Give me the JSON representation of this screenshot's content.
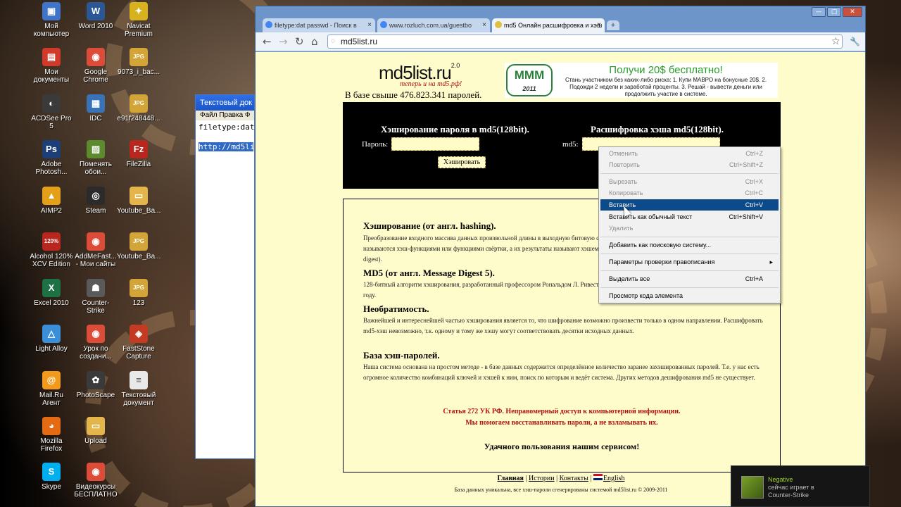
{
  "desktop": {
    "icons": [
      {
        "label": "Мой компьютер",
        "glyph": "▣",
        "color": "#3f74c8"
      },
      {
        "label": "Word 2010",
        "glyph": "W",
        "color": "#2b5797"
      },
      {
        "label": "Navicat Premium",
        "glyph": "✦",
        "color": "#d7b21e"
      },
      {
        "label": "Мои документы",
        "glyph": "▤",
        "color": "#cf3a2a"
      },
      {
        "label": "Google Chrome",
        "glyph": "◉",
        "color": "#dd4b39"
      },
      {
        "label": "9073_i_bac...",
        "glyph": "JPG",
        "color": "#d3a437"
      },
      {
        "label": "ACDSee Pro 5",
        "glyph": "◐",
        "color": "#3a3a3a"
      },
      {
        "label": "IDC",
        "glyph": "▦",
        "color": "#3a72b8"
      },
      {
        "label": "e91f248448...",
        "glyph": "JPG",
        "color": "#d3a437"
      },
      {
        "label": "Adobe Photosh...",
        "glyph": "Ps",
        "color": "#1d3f77"
      },
      {
        "label": "Поменять обои...",
        "glyph": "▨",
        "color": "#5c8b2e"
      },
      {
        "label": "FileZilla",
        "glyph": "Fz",
        "color": "#b8261e"
      },
      {
        "label": "AIMP2",
        "glyph": "▲",
        "color": "#e5a01a"
      },
      {
        "label": "Steam",
        "glyph": "◎",
        "color": "#2b2b2b"
      },
      {
        "label": "Youtube_Ba...",
        "glyph": "▭",
        "color": "#e3b54a"
      },
      {
        "label": "Alcohol 120% XCV Edition",
        "glyph": "120%",
        "color": "#b8261e"
      },
      {
        "label": "AddMeFast... - Мои сайты",
        "glyph": "◉",
        "color": "#dd4b39"
      },
      {
        "label": "Youtube_Ba...",
        "glyph": "JPG",
        "color": "#d3a437"
      },
      {
        "label": "Excel 2010",
        "glyph": "X",
        "color": "#1e7145"
      },
      {
        "label": "Counter-Strike",
        "glyph": "☗",
        "color": "#5a5a5a"
      },
      {
        "label": "123",
        "glyph": "JPG",
        "color": "#d3a437"
      },
      {
        "label": "Light Alloy",
        "glyph": "△",
        "color": "#3a8fd8"
      },
      {
        "label": "Урок по создани...",
        "glyph": "◉",
        "color": "#dd4b39"
      },
      {
        "label": "FastStone Capture",
        "glyph": "◈",
        "color": "#c23b22"
      },
      {
        "label": "Mail.Ru Агент",
        "glyph": "@",
        "color": "#f39a1d"
      },
      {
        "label": "PhotoScape",
        "glyph": "✿",
        "color": "#3a3a3a"
      },
      {
        "label": "Текстовый документ",
        "glyph": "≡",
        "color": "#e9e9e9"
      },
      {
        "label": "Mozilla Firefox",
        "glyph": "◕",
        "color": "#e46a14"
      },
      {
        "label": "Upload",
        "glyph": "▭",
        "color": "#e3b54a"
      },
      {
        "label": "Skype",
        "glyph": "S",
        "color": "#00aff0"
      },
      {
        "label": "Видеокурсы БЕСПЛАТНО",
        "glyph": "◉",
        "color": "#dd4b39"
      }
    ]
  },
  "notepad": {
    "title": "Текстовый док",
    "menu": "Файл  Правка  Ф",
    "line1": "filetype:dat",
    "selected": "http://md5li"
  },
  "browser": {
    "tabs": [
      {
        "label": "filetype:dat passwd - Поиск в",
        "fav": "#4285f4"
      },
      {
        "label": "www.rozluch.com.ua/guestbo",
        "fav": "#4285f4"
      },
      {
        "label": "md5 Онлайн расшифровка и хэш",
        "fav": "#e0c040"
      }
    ],
    "url": "md5list.ru",
    "win": {
      "min": "—",
      "max": "▢",
      "close": "✕"
    },
    "nav": {
      "back": "←",
      "fwd": "→",
      "reload": "↻",
      "home": "⌂",
      "star": "☆",
      "wrench": "🔧"
    }
  },
  "page": {
    "logo": "md5list.ru",
    "logo_ver": "2.0",
    "tagline": "теперь и на md5.рф!",
    "counter": "В базе свыше 476.823.341 паролей.",
    "ad": {
      "logo": "МММ",
      "year": "2011",
      "title": "Получи 20$ бесплатно!",
      "text": "Стань участником без каких-либо риска: 1. Купи МАВРО на бонусные 20$. 2. Подожди 2 недели и заработай проценты. 3. Решай - вывести деньги или продолжить участие в системе."
    },
    "hash_title": "Хэширование пароля в md5(128bit).",
    "decode_title": "Расшифровка хэша md5(128bit).",
    "password_label": "Пароль:",
    "md5_label": "md5:",
    "hash_button": "Хэшировать",
    "sections": [
      {
        "h": "Хэширование (от англ. hashing).",
        "t": "Преобразование входного массива данных произвольной длины в выходную битовую строку фиксированной длины. Такие преобразования также называются хэш-функциями или функциями свёртки, а их результаты называют хэшем, хэш-кодом или дайджестом сообщения (англ. message digest)."
      },
      {
        "h": "MD5 (от англ. Message Digest 5).",
        "t": "128-битный алгоритм хэширования, разработанный профессором Рональдом Л. Ривестом из Массачусетского технологического института в 1991 году."
      },
      {
        "h": "Необратимость.",
        "t": "Важнейшей и интереснейшей частью хэширования является то, что шифрование возможно произвести только в одном направлении. Расшифровать md5-хэш невозможно, т.к. одному и тому же хэшу могут соответствовать десятки исходных данных."
      },
      {
        "h": "База хэш-паролей.",
        "t": "Наша система основана на простом методе - в базе данных содержится определённое количество заранее захэшированных паролей. Т.е. у нас есть огромное количество комбинаций ключей и хэшей к ним, поиск по которым и ведёт система. Других методов дешифрования md5 не существует."
      }
    ],
    "warning1": "Статья 272 УК РФ. Неправомерный доступ к компьютерной информации.",
    "warning2": "Мы помогаем восстанавливать пароли, а не взламывать их.",
    "thanks": "Удачного пользования нашим сервисом!",
    "footer_links": [
      "Главная",
      "Истории",
      "Контакты",
      "English"
    ],
    "copyright": "База данных уникальна, все хэш-пароли сгенерированы системой md5list.ru © 2009-2011"
  },
  "context_menu": [
    {
      "label": "Отменить",
      "shortcut": "Ctrl+Z",
      "disabled": true
    },
    {
      "label": "Повторить",
      "shortcut": "Ctrl+Shift+Z",
      "disabled": true
    },
    {
      "label": "Вырезать",
      "shortcut": "Ctrl+X",
      "disabled": true
    },
    {
      "label": "Копировать",
      "shortcut": "Ctrl+C",
      "disabled": true
    },
    {
      "label": "Вставить",
      "shortcut": "Ctrl+V",
      "highlighted": true
    },
    {
      "label": "Вставить как обычный текст",
      "shortcut": "Ctrl+Shift+V"
    },
    {
      "label": "Удалить",
      "shortcut": "",
      "disabled": true
    },
    {
      "label": "Добавить как поисковую систему...",
      "shortcut": ""
    },
    {
      "label": "Параметры проверки правописания",
      "shortcut": "",
      "submenu": true
    },
    {
      "label": "Выделить все",
      "shortcut": "Ctrl+A"
    },
    {
      "label": "Просмотр кода элемента",
      "shortcut": ""
    }
  ],
  "toast": {
    "name": "Negative",
    "line2": "сейчас играет в",
    "line3": "Counter-Strike"
  }
}
